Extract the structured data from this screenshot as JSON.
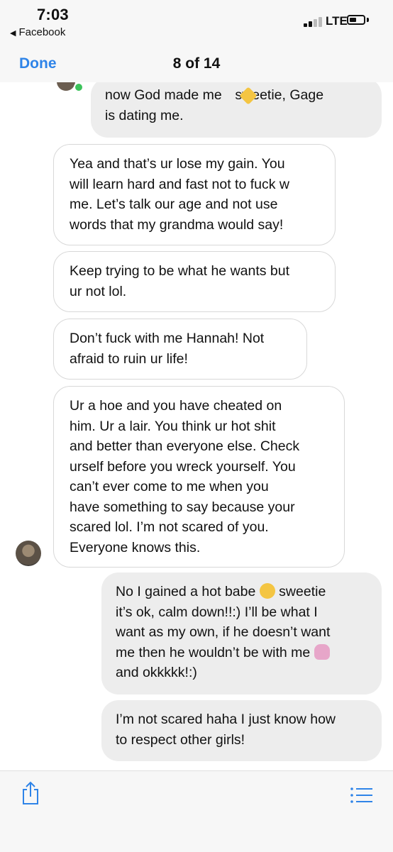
{
  "status_bar": {
    "time": "7:03",
    "back_app": "Facebook",
    "network": "LTE"
  },
  "nav": {
    "done_label": "Done",
    "counter": "8 of 14"
  },
  "messages": [
    {
      "direction": "outgoing",
      "text_lines": [
        "now God made me    sweetie, Gage",
        "is dating me."
      ]
    },
    {
      "direction": "incoming",
      "text_lines": [
        "Yea and that’s ur lose my gain. You",
        "will learn hard and fast not to fuck w",
        "me. Let’s talk our age and not use",
        "words that my grandma would say!"
      ]
    },
    {
      "direction": "incoming",
      "text_lines": [
        "Keep trying to be what he wants but",
        "ur not lol."
      ]
    },
    {
      "direction": "incoming",
      "text_lines": [
        "Don’t fuck with me Hannah! Not",
        "afraid to ruin ur life!"
      ]
    },
    {
      "direction": "incoming",
      "text_lines": [
        "Ur a hoe and you have cheated on",
        "him. Ur a lair. You think ur hot shit",
        "and better than everyone else. Check",
        "urself before you wreck yourself. You",
        "can’t ever come to me when you",
        "have something to say because your",
        "scared lol. I’m not scared of you.",
        "Everyone knows this."
      ]
    },
    {
      "direction": "outgoing",
      "text_lines": [
        "No I gained a hot babe",
        "sweetie",
        "it’s ok, calm down!!:) I’ll be what I",
        "want as my own, if he doesn’t want",
        "me then he wouldn’t be with me",
        "and okkkkk!:)"
      ]
    },
    {
      "direction": "outgoing",
      "text_lines": [
        "I’m not scared haha I just know how",
        "to respect other girls!"
      ]
    }
  ],
  "icons": {
    "share": "share-icon",
    "list": "list-icon"
  },
  "colors": {
    "accent": "#2f84e8",
    "outgoing_bubble": "#ededed",
    "incoming_border": "#d8d8d8"
  }
}
